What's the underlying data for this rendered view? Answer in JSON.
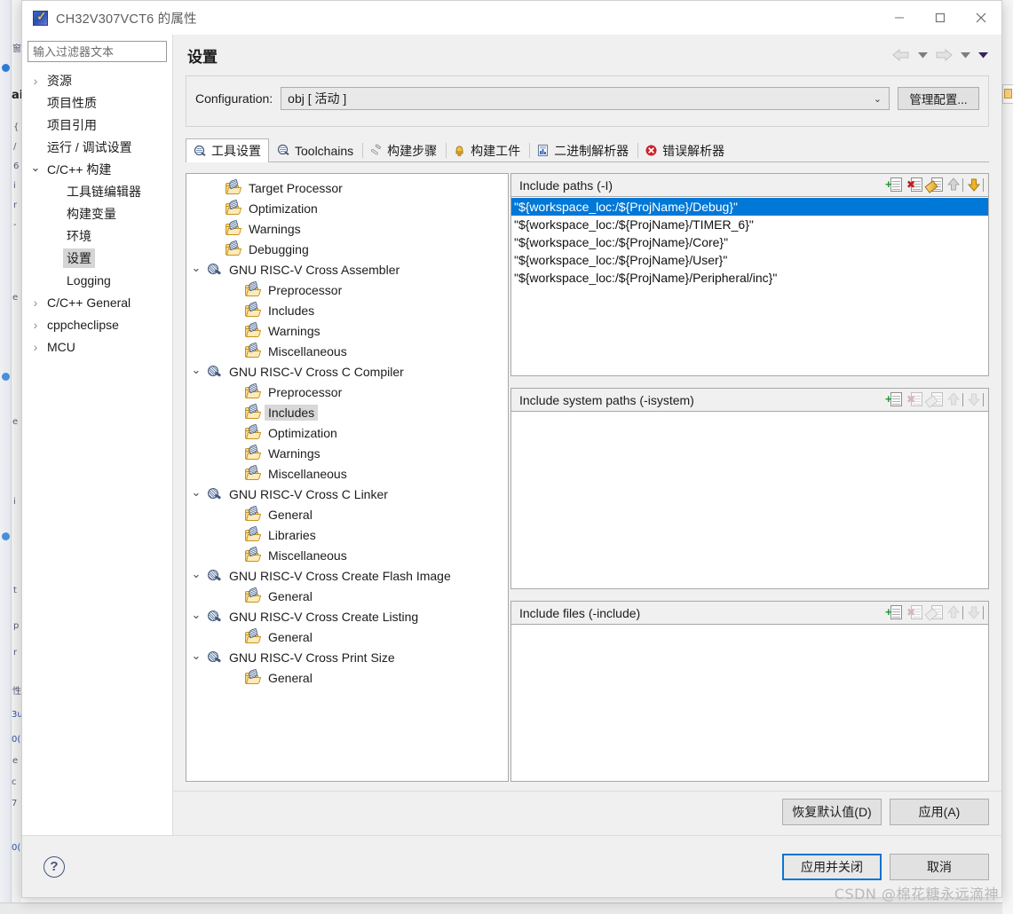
{
  "window": {
    "title": "CH32V307VCT6 的属性",
    "app_icon": "eclipse-app-icon",
    "minimize": "−",
    "maximize": "□",
    "close": "✕"
  },
  "left_nav": {
    "filter_placeholder": "输入过滤器文本",
    "items": [
      {
        "label": "资源",
        "indent": 0,
        "twisty": "collapsed",
        "selected": false
      },
      {
        "label": "项目性质",
        "indent": 0,
        "twisty": "none",
        "selected": false
      },
      {
        "label": "项目引用",
        "indent": 0,
        "twisty": "none",
        "selected": false
      },
      {
        "label": "运行 / 调试设置",
        "indent": 0,
        "twisty": "none",
        "selected": false
      },
      {
        "label": "C/C++ 构建",
        "indent": 0,
        "twisty": "expanded",
        "selected": false
      },
      {
        "label": "工具链编辑器",
        "indent": 1,
        "twisty": "none",
        "selected": false
      },
      {
        "label": "构建变量",
        "indent": 1,
        "twisty": "none",
        "selected": false
      },
      {
        "label": "环境",
        "indent": 1,
        "twisty": "none",
        "selected": false
      },
      {
        "label": "设置",
        "indent": 1,
        "twisty": "none",
        "selected": true
      },
      {
        "label": "Logging",
        "indent": 1,
        "twisty": "none",
        "selected": false
      },
      {
        "label": "C/C++ General",
        "indent": 0,
        "twisty": "collapsed",
        "selected": false
      },
      {
        "label": "cppcheclipse",
        "indent": 0,
        "twisty": "collapsed",
        "selected": false
      },
      {
        "label": "MCU",
        "indent": 0,
        "twisty": "collapsed",
        "selected": false
      }
    ]
  },
  "header": {
    "page_title": "设置",
    "nav_back_icon": "back-arrow-icon",
    "nav_forward_icon": "forward-arrow-icon",
    "nav_menu_icon": "chevron-down-icon"
  },
  "config": {
    "label": "Configuration:",
    "value": "obj [ 活动 ]",
    "chevron": "⌄",
    "manage_button": "管理配置..."
  },
  "tabs": [
    {
      "label": "工具设置",
      "icon": "tool-settings-icon",
      "active": true
    },
    {
      "label": "Toolchains",
      "icon": "toolchains-icon",
      "active": false
    },
    {
      "label": "构建步骤",
      "icon": "build-steps-icon",
      "active": false
    },
    {
      "label": "构建工件",
      "icon": "build-artifact-icon",
      "active": false
    },
    {
      "label": "二进制解析器",
      "icon": "binary-parser-icon",
      "active": false
    },
    {
      "label": "错误解析器",
      "icon": "error-parser-icon",
      "active": false
    }
  ],
  "tool_tree": [
    {
      "label": "Target Processor",
      "indent": 1,
      "twisty": "none",
      "icon": "folder-tool-icon",
      "selected": false
    },
    {
      "label": "Optimization",
      "indent": 1,
      "twisty": "none",
      "icon": "folder-tool-icon",
      "selected": false
    },
    {
      "label": "Warnings",
      "indent": 1,
      "twisty": "none",
      "icon": "folder-tool-icon",
      "selected": false
    },
    {
      "label": "Debugging",
      "indent": 1,
      "twisty": "none",
      "icon": "folder-tool-icon",
      "selected": false
    },
    {
      "label": "GNU RISC-V Cross Assembler",
      "indent": 0,
      "twisty": "expanded",
      "icon": "tool-icon",
      "selected": false
    },
    {
      "label": "Preprocessor",
      "indent": 2,
      "twisty": "none",
      "icon": "folder-tool-icon",
      "selected": false
    },
    {
      "label": "Includes",
      "indent": 2,
      "twisty": "none",
      "icon": "folder-tool-icon",
      "selected": false
    },
    {
      "label": "Warnings",
      "indent": 2,
      "twisty": "none",
      "icon": "folder-tool-icon",
      "selected": false
    },
    {
      "label": "Miscellaneous",
      "indent": 2,
      "twisty": "none",
      "icon": "folder-tool-icon",
      "selected": false
    },
    {
      "label": "GNU RISC-V Cross C Compiler",
      "indent": 0,
      "twisty": "expanded",
      "icon": "tool-icon",
      "selected": false
    },
    {
      "label": "Preprocessor",
      "indent": 2,
      "twisty": "none",
      "icon": "folder-tool-icon",
      "selected": false
    },
    {
      "label": "Includes",
      "indent": 2,
      "twisty": "none",
      "icon": "folder-tool-icon",
      "selected": true
    },
    {
      "label": "Optimization",
      "indent": 2,
      "twisty": "none",
      "icon": "folder-tool-icon",
      "selected": false
    },
    {
      "label": "Warnings",
      "indent": 2,
      "twisty": "none",
      "icon": "folder-tool-icon",
      "selected": false
    },
    {
      "label": "Miscellaneous",
      "indent": 2,
      "twisty": "none",
      "icon": "folder-tool-icon",
      "selected": false
    },
    {
      "label": "GNU RISC-V Cross C Linker",
      "indent": 0,
      "twisty": "expanded",
      "icon": "tool-icon",
      "selected": false
    },
    {
      "label": "General",
      "indent": 2,
      "twisty": "none",
      "icon": "folder-tool-icon",
      "selected": false
    },
    {
      "label": "Libraries",
      "indent": 2,
      "twisty": "none",
      "icon": "folder-tool-icon",
      "selected": false
    },
    {
      "label": "Miscellaneous",
      "indent": 2,
      "twisty": "none",
      "icon": "folder-tool-icon",
      "selected": false
    },
    {
      "label": "GNU RISC-V Cross Create Flash Image",
      "indent": 0,
      "twisty": "expanded",
      "icon": "tool-icon",
      "selected": false
    },
    {
      "label": "General",
      "indent": 2,
      "twisty": "none",
      "icon": "folder-tool-icon",
      "selected": false
    },
    {
      "label": "GNU RISC-V Cross Create Listing",
      "indent": 0,
      "twisty": "expanded",
      "icon": "tool-icon",
      "selected": false
    },
    {
      "label": "General",
      "indent": 2,
      "twisty": "none",
      "icon": "folder-tool-icon",
      "selected": false
    },
    {
      "label": "GNU RISC-V Cross Print Size",
      "indent": 0,
      "twisty": "expanded",
      "icon": "tool-icon",
      "selected": false
    },
    {
      "label": "General",
      "indent": 2,
      "twisty": "none",
      "icon": "folder-tool-icon",
      "selected": false
    }
  ],
  "lists": [
    {
      "title": "Include paths (-I)",
      "tools_enabled": true,
      "tools": [
        "add-icon",
        "delete-icon",
        "edit-icon",
        "move-up-icon",
        "move-down-icon"
      ],
      "items": [
        {
          "text": "\"${workspace_loc:/${ProjName}/Debug}\"",
          "selected": true
        },
        {
          "text": "\"${workspace_loc:/${ProjName}/TIMER_6}\"",
          "selected": false
        },
        {
          "text": "\"${workspace_loc:/${ProjName}/Core}\"",
          "selected": false
        },
        {
          "text": "\"${workspace_loc:/${ProjName}/User}\"",
          "selected": false
        },
        {
          "text": "\"${workspace_loc:/${ProjName}/Peripheral/inc}\"",
          "selected": false
        }
      ]
    },
    {
      "title": "Include system paths (-isystem)",
      "tools_enabled": false,
      "tools": [
        "add-icon",
        "delete-icon",
        "edit-icon",
        "move-up-icon",
        "move-down-icon"
      ],
      "items": []
    },
    {
      "title": "Include files (-include)",
      "tools_enabled": false,
      "tools": [
        "add-icon",
        "delete-icon",
        "edit-icon",
        "move-up-icon",
        "move-down-icon"
      ],
      "items": []
    }
  ],
  "apply_row": {
    "restore_defaults": "恢复默认值(D)",
    "apply": "应用(A)"
  },
  "footer": {
    "help_icon": "help-icon",
    "help_glyph": "?",
    "apply_and_close": "应用并关闭",
    "cancel": "取消"
  },
  "watermark": "CSDN @棉花糖永远滴神",
  "colors": {
    "selection_blue": "#0078d7",
    "focus_border": "#0a74d1",
    "dialog_bg": "#f0f0f0",
    "folder_yellow": "#fcd98a"
  }
}
